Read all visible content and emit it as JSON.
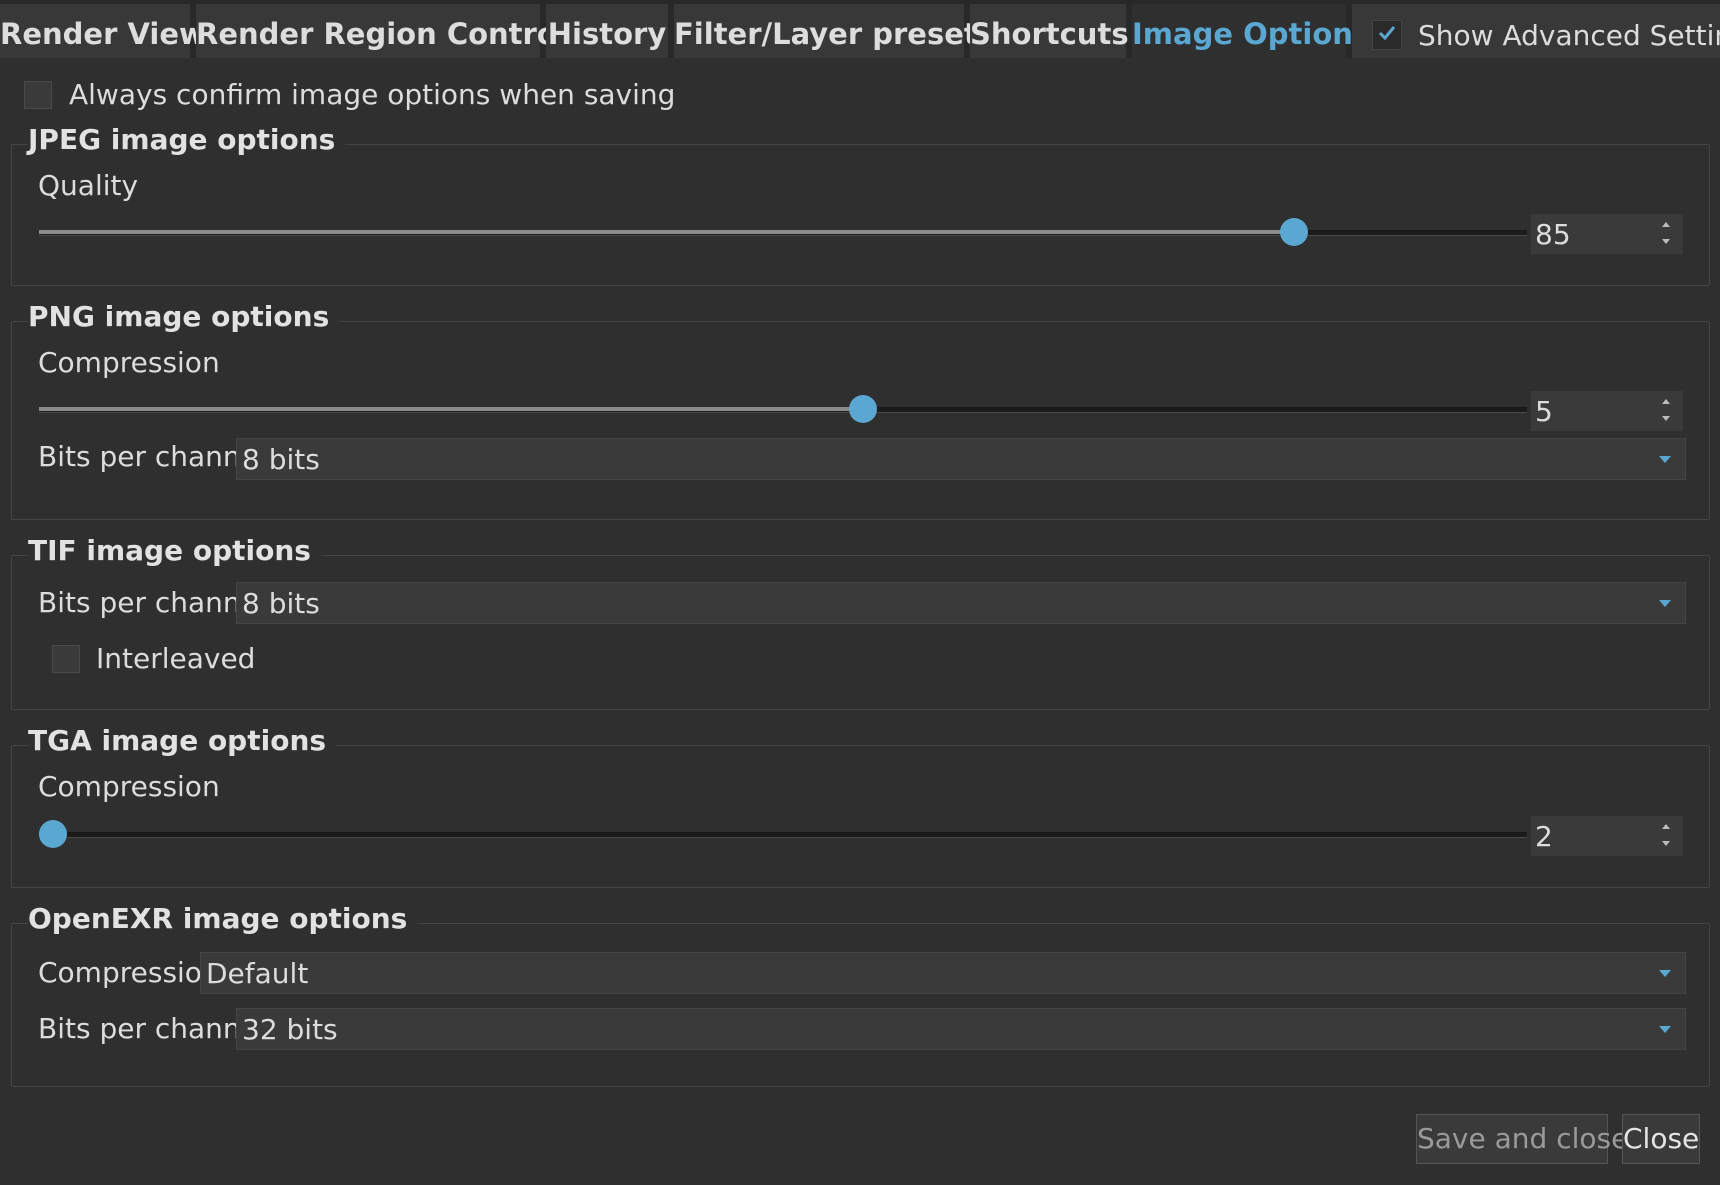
{
  "tabs": [
    {
      "label": "Render View",
      "active": false
    },
    {
      "label": "Render Region Controls",
      "active": false
    },
    {
      "label": "History",
      "active": false
    },
    {
      "label": "Filter/Layer presets",
      "active": false
    },
    {
      "label": "Shortcuts",
      "active": false
    },
    {
      "label": "Image Options",
      "active": true
    }
  ],
  "advanced": {
    "label": "Show Advanced Settings",
    "checked": true
  },
  "always_confirm": {
    "label": "Always confirm image options when saving",
    "checked": false
  },
  "jpeg": {
    "title": "JPEG image options",
    "quality": {
      "label": "Quality",
      "value": "85",
      "fraction": 0.85
    }
  },
  "png": {
    "title": "PNG image options",
    "compression": {
      "label": "Compression",
      "value": "5",
      "fraction": 0.555
    },
    "bits": {
      "label": "Bits per channel",
      "value": "8 bits"
    }
  },
  "tif": {
    "title": "TIF image options",
    "bits": {
      "label": "Bits per channel",
      "value": "8 bits"
    },
    "interleaved": {
      "label": "Interleaved",
      "checked": false
    }
  },
  "tga": {
    "title": "TGA image options",
    "compression": {
      "label": "Compression",
      "value": "2",
      "fraction": 0.0
    }
  },
  "exr": {
    "title": "OpenEXR image options",
    "compression": {
      "label": "Compression",
      "value": "Default"
    },
    "bits": {
      "label": "Bits per channel",
      "value": "32 bits"
    }
  },
  "buttons": {
    "save_close": {
      "label": "Save and close",
      "enabled": false
    },
    "close": {
      "label": "Close",
      "enabled": true
    }
  },
  "colors": {
    "accent": "#5aa7d2",
    "background": "#2f2f2f",
    "tabbar": "#282828",
    "widget": "#3a3a3a"
  }
}
